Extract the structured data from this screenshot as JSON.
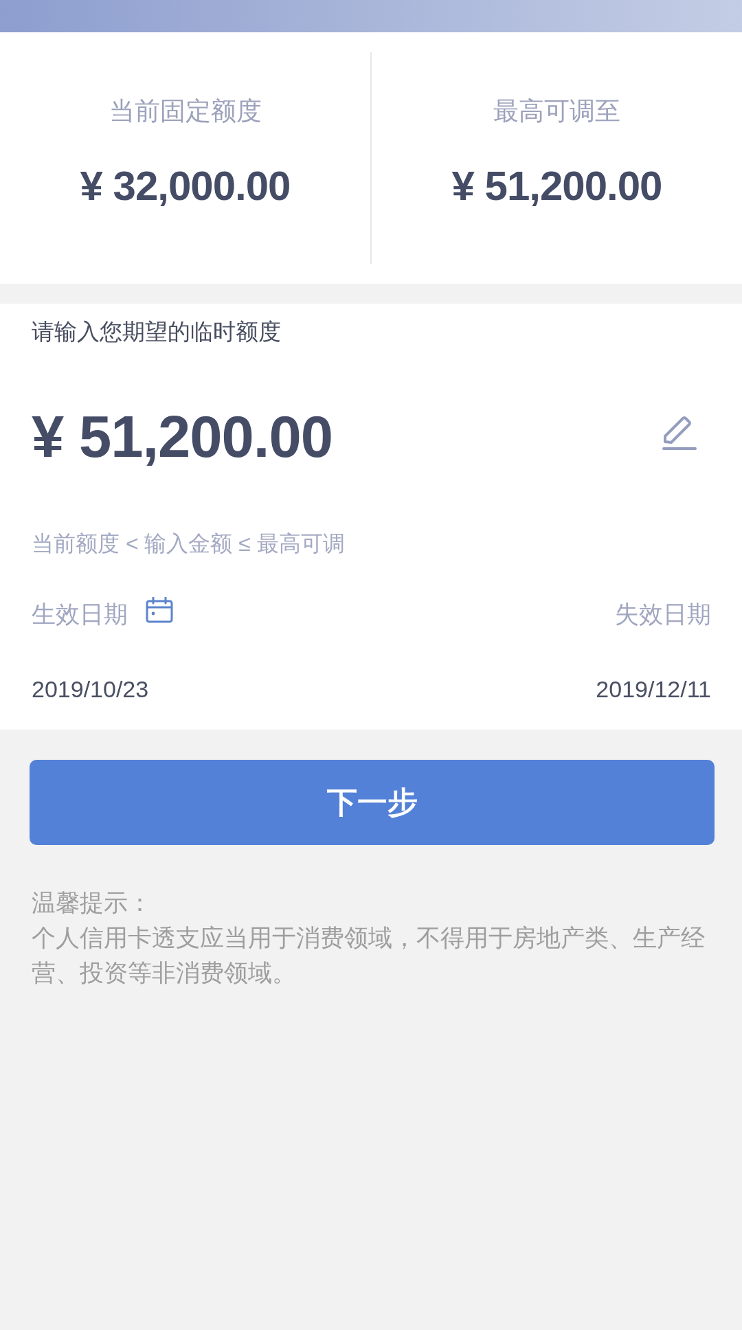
{
  "limits": [
    {
      "label": "当前固定额度",
      "amount": "¥ 32,000.00"
    },
    {
      "label": "最高可调至",
      "amount": "¥ 51,200.00"
    }
  ],
  "temporary_limit": {
    "prompt": "请输入您期望的临时额度",
    "value": "¥ 51,200.00",
    "hint": "当前额度 < 输入金额 ≤ 最高可调"
  },
  "dates": [
    {
      "label": "生效日期",
      "value": "2019/10/23",
      "calendar_icon": true
    },
    {
      "label": "失效日期",
      "value": "2019/12/11",
      "calendar_icon": false
    }
  ],
  "next_button": {
    "label": "下一步"
  },
  "tips": {
    "title": "温馨提示：",
    "text": "个人信用卡透支应当用于消费领域，不得用于房地产类、生产经营、投资等非消费领域。"
  }
}
